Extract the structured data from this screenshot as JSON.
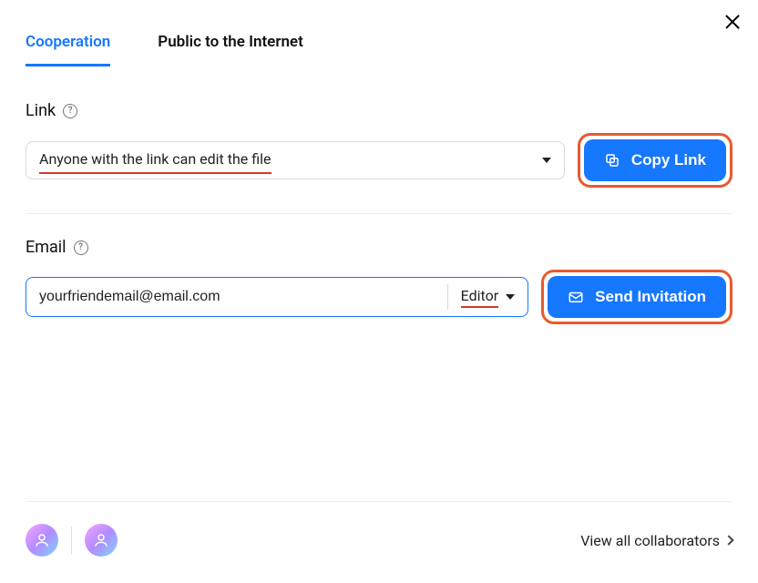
{
  "close_aria": "Close",
  "tabs": {
    "cooperation": "Cooperation",
    "public": "Public to the Internet"
  },
  "link_section": {
    "label": "Link",
    "help": "?",
    "selected": "Anyone with the link can edit the file",
    "copy_button": "Copy Link"
  },
  "email_section": {
    "label": "Email",
    "help": "?",
    "input_value": "yourfriendemail@email.com",
    "permission": "Editor",
    "send_button": "Send Invitation"
  },
  "footer": {
    "view_all": "View all collaborators"
  }
}
